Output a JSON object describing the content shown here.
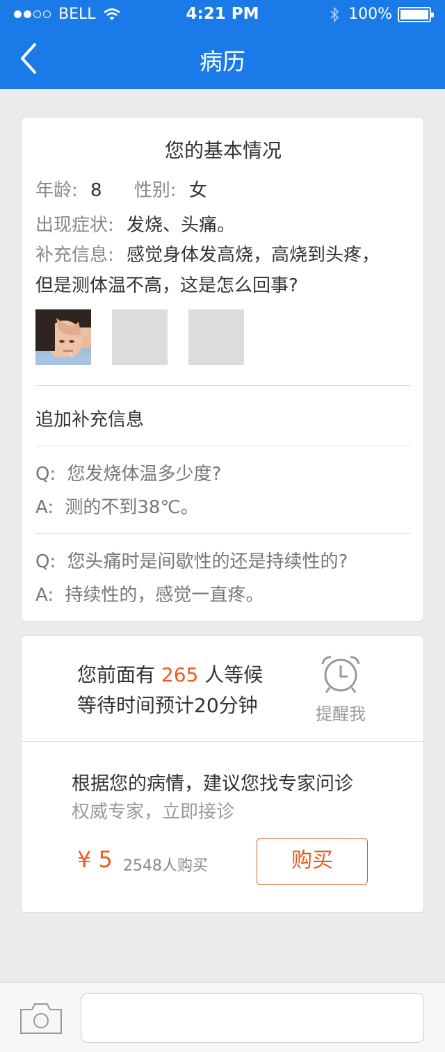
{
  "status_bar": {
    "carrier": "BELL",
    "time": "4:21 PM",
    "battery": "100%"
  },
  "nav": {
    "title": "病历"
  },
  "basic_info": {
    "title": "您的基本情况",
    "age_label": "年龄:",
    "age_value": "8",
    "gender_label": "性别:",
    "gender_value": "女",
    "symptom_label": "出现症状:",
    "symptom_value": "发烧、头痛。",
    "extra_label": "补充信息:",
    "extra_line1": "感觉身体发高烧，高烧到头疼，",
    "extra_line2": "但是测体温不高，这是怎么回事?"
  },
  "additional": {
    "title": "追加补充信息",
    "qa": [
      {
        "q_prefix": "Q:",
        "q": "您发烧体温多少度?",
        "a_prefix": "A:",
        "a": "测的不到38℃。"
      },
      {
        "q_prefix": "Q:",
        "q": "您头痛时是间歇性的还是持续性的?",
        "a_prefix": "A:",
        "a": "持续性的，感觉一直疼。"
      }
    ]
  },
  "queue": {
    "before": "您前面有",
    "count": "265",
    "after": "人等候",
    "wait": "等待时间预计20分钟",
    "remind": "提醒我"
  },
  "expert": {
    "title": "根据您的病情，建议您找专家问诊",
    "subtitle": "权威专家，立即接诊",
    "price": "¥ 5",
    "sold": "2548人购买",
    "buy": "购买"
  },
  "colors": {
    "header": "#1a7be8",
    "accent": "#f05a1e"
  },
  "icons": {
    "back": "chevron-left-icon",
    "camera": "camera-icon",
    "alarm": "alarm-clock-icon",
    "bluetooth": "bluetooth-icon",
    "wifi": "wifi-icon",
    "battery": "battery-icon"
  }
}
